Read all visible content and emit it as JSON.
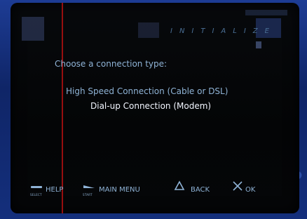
{
  "screen": {
    "title": "INITIALIZE",
    "prompt": "Choose a connection type:",
    "options": [
      {
        "label": "High Speed Connection (Cable or DSL)",
        "selected": false
      },
      {
        "label": "Dial-up Connection (Modem)",
        "selected": true
      }
    ]
  },
  "footer": {
    "help": {
      "icon": "select-button-icon",
      "button_caption": "SELECT",
      "label": "HELP"
    },
    "main_menu": {
      "icon": "start-button-icon",
      "button_caption": "START",
      "label": "MAIN MENU"
    },
    "back": {
      "icon": "triangle-icon",
      "label": "BACK"
    },
    "ok": {
      "icon": "cross-icon",
      "label": "OK"
    }
  },
  "colors": {
    "text_muted": "#8fb3d6",
    "text_selected": "#f2f6ff",
    "frame_blue": "#1d3c94",
    "screen_bg": "#050608",
    "accent_red": "#b01010"
  }
}
